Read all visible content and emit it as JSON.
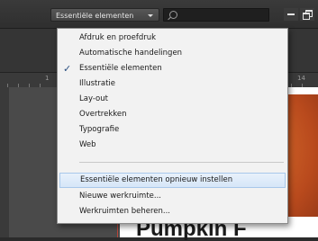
{
  "toolbar": {
    "workspace_label": "Essentiële elementen",
    "search_placeholder": ""
  },
  "ruler": {
    "marks": [
      "1",
      "14"
    ]
  },
  "document": {
    "headline": "Pumpkin F"
  },
  "menu": {
    "items": [
      {
        "label": "Afdruk en proefdruk",
        "checked": false
      },
      {
        "label": "Automatische handelingen",
        "checked": false
      },
      {
        "label": "Essentiële elementen",
        "checked": true
      },
      {
        "label": "Illustratie",
        "checked": false
      },
      {
        "label": "Lay-out",
        "checked": false
      },
      {
        "label": "Overtrekken",
        "checked": false
      },
      {
        "label": "Typografie",
        "checked": false
      },
      {
        "label": "Web",
        "checked": false
      }
    ],
    "actions": [
      {
        "label": "Essentiële elementen opnieuw instellen",
        "highlighted": true
      },
      {
        "label": "Nieuwe werkruimte...",
        "highlighted": false
      },
      {
        "label": "Werkruimten beheren...",
        "highlighted": false
      }
    ],
    "check_glyph": "✓"
  }
}
